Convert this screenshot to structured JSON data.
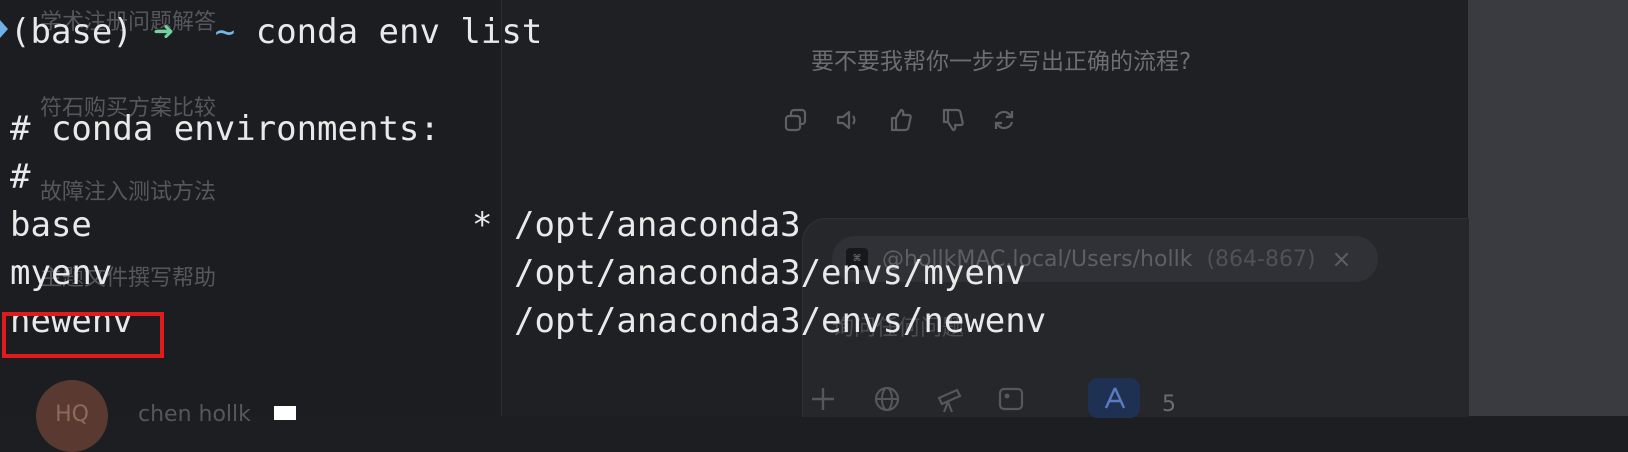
{
  "sidebar": {
    "items": [
      {
        "label": "学术注册问题解答"
      },
      {
        "label": "符石购买方案比较"
      },
      {
        "label": "故障注入测试方法"
      },
      {
        "label": "主题文件撰写帮助"
      }
    ],
    "user": {
      "avatar_text": "HQ",
      "name": "chen hollk"
    }
  },
  "chat": {
    "assistant_question": "要不要我帮你一步步写出正确的流程?",
    "actions": [
      "copy-icon",
      "read-aloud-icon",
      "thumbs-up-icon",
      "thumbs-down-icon",
      "regenerate-icon"
    ],
    "composer": {
      "context_chip": {
        "path": "@hollkMAC.local/Users/hollk",
        "range": "(864-867)",
        "close": "×"
      },
      "placeholder": "询问任何问题",
      "tools": [
        "add-icon",
        "globe-icon",
        "telescope-icon",
        "image-tool-icon",
        "app-icon"
      ],
      "tool_count": "5"
    }
  },
  "terminal": {
    "prompt": {
      "env": "(base)",
      "arrow": "➜",
      "dir": "~",
      "command": "conda env list"
    },
    "header": "# conda environments:",
    "hash_line": "#",
    "envs": [
      {
        "name": "base",
        "active": "*",
        "path": "/opt/anaconda3"
      },
      {
        "name": "myenv",
        "active": "",
        "path": "/opt/anaconda3/envs/myenv"
      },
      {
        "name": "newenv",
        "active": "",
        "path": "/opt/anaconda3/envs/newenv"
      }
    ]
  },
  "colors": {
    "highlight": "#e01b1b",
    "prompt_arrow": "#6fd39a",
    "prompt_tilde": "#72b8e8"
  }
}
